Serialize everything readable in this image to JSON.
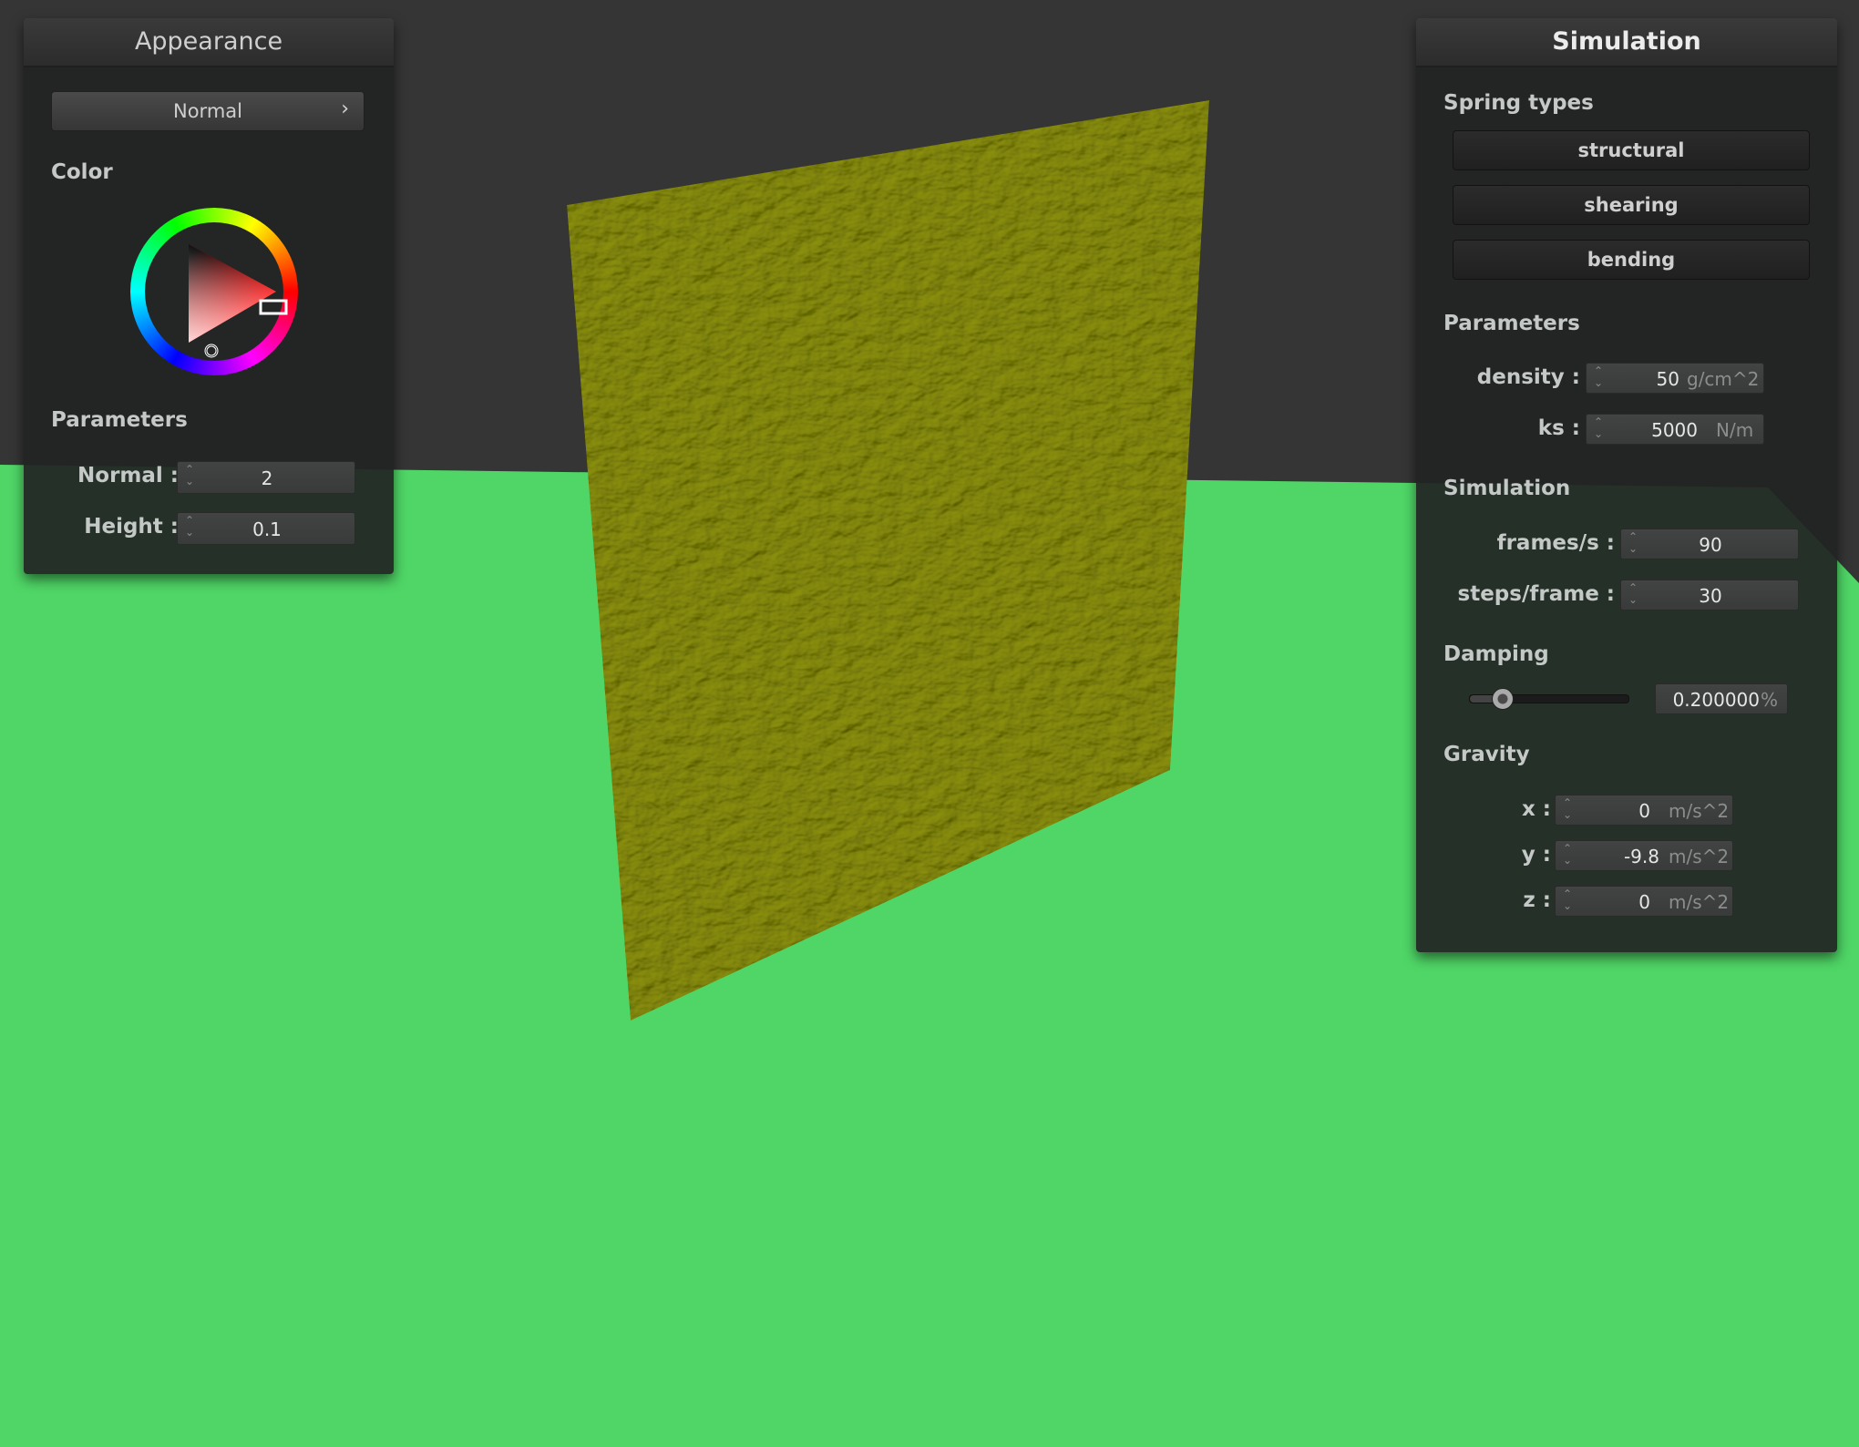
{
  "appearance": {
    "title": "Appearance",
    "mode_button": "Normal",
    "color_label": "Color",
    "selected_color": "#ff0000",
    "parameters_label": "Parameters",
    "normal": {
      "label": "Normal :",
      "value": "2"
    },
    "height": {
      "label": "Height :",
      "value": "0.1"
    }
  },
  "simulation": {
    "title": "Simulation",
    "spring_types_label": "Spring types",
    "spring_types": [
      "structural",
      "shearing",
      "bending"
    ],
    "parameters_label": "Parameters",
    "density": {
      "label": "density :",
      "value": "50",
      "unit": "g/cm^2"
    },
    "ks": {
      "label": "ks :",
      "value": "5000",
      "unit": "N/m"
    },
    "simulation_label": "Simulation",
    "fps": {
      "label": "frames/s :",
      "value": "90"
    },
    "steps": {
      "label": "steps/frame :",
      "value": "30"
    },
    "damping_label": "Damping",
    "damping": {
      "value": "0.200000",
      "unit": "%",
      "level": 0.2
    },
    "gravity_label": "Gravity",
    "gravity": {
      "x": {
        "label": "x :",
        "value": "0",
        "unit": "m/s^2"
      },
      "y": {
        "label": "y :",
        "value": "-9.8",
        "unit": "m/s^2"
      },
      "z": {
        "label": "z :",
        "value": "0",
        "unit": "m/s^2"
      }
    }
  },
  "scene": {
    "sky_color": "#353535",
    "ground_color": "#4fd666",
    "cloth_color": "#8a8f0a"
  }
}
